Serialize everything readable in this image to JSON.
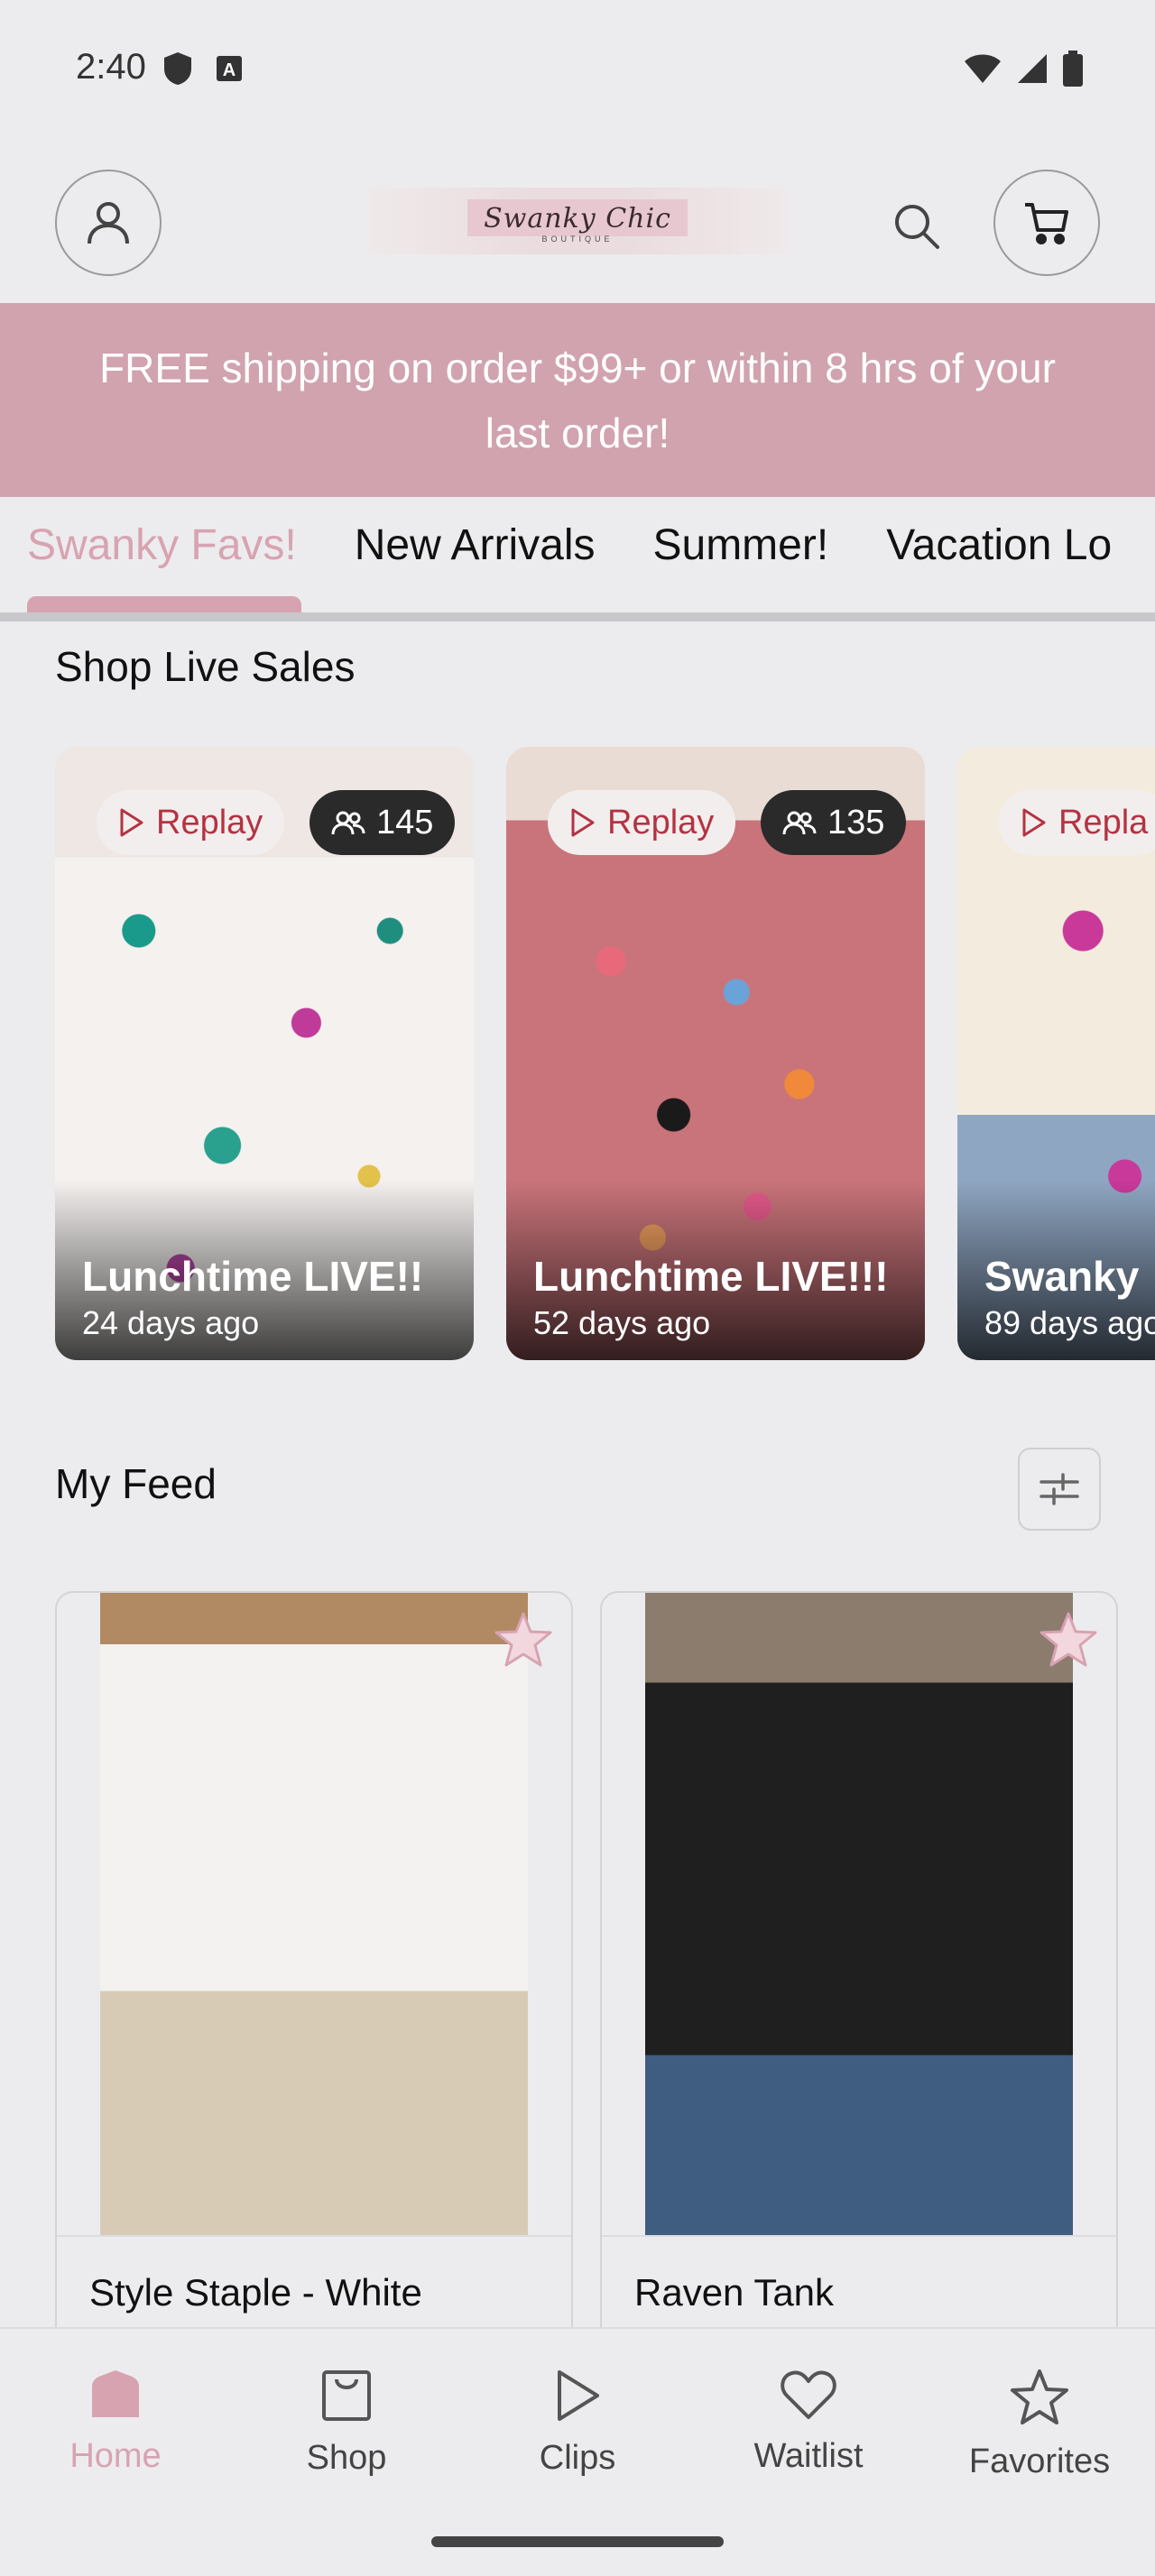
{
  "status_bar": {
    "time": "2:40"
  },
  "header": {
    "logo_text": "Swanky Chic",
    "logo_subtext": "BOUTIQUE"
  },
  "promo": {
    "text": "FREE shipping on order $99+ or within 8 hrs of your last order!"
  },
  "tabs": [
    {
      "label": "Swanky Favs!",
      "active": true
    },
    {
      "label": "New Arrivals"
    },
    {
      "label": "Summer!"
    },
    {
      "label": "Vacation Lo"
    }
  ],
  "live_sales": {
    "title": "Shop Live Sales",
    "cards": [
      {
        "replay_label": "Replay",
        "viewers": "145",
        "title": "Lunchtime LIVE!!",
        "ago": "24 days ago"
      },
      {
        "replay_label": "Replay",
        "viewers": "135",
        "title": "Lunchtime LIVE!!!",
        "ago": "52 days ago"
      },
      {
        "replay_label": "Repla",
        "viewers": "",
        "title": "Swanky",
        "ago": "89 days ago"
      }
    ]
  },
  "feed": {
    "title": "My Feed",
    "items": [
      {
        "name": "Style Staple - White"
      },
      {
        "name": "Raven Tank"
      }
    ]
  },
  "bottom_nav": [
    {
      "label": "Home",
      "icon": "home-icon",
      "active": true
    },
    {
      "label": "Shop",
      "icon": "shopping-bag-icon"
    },
    {
      "label": "Clips",
      "icon": "play-icon"
    },
    {
      "label": "Waitlist",
      "icon": "heart-icon"
    },
    {
      "label": "Favorites",
      "icon": "star-icon"
    }
  ],
  "colors": {
    "accent": "#d8a3b1",
    "promo_bg": "#d0a3ae",
    "replay_text": "#b43342",
    "background": "#ececee"
  }
}
